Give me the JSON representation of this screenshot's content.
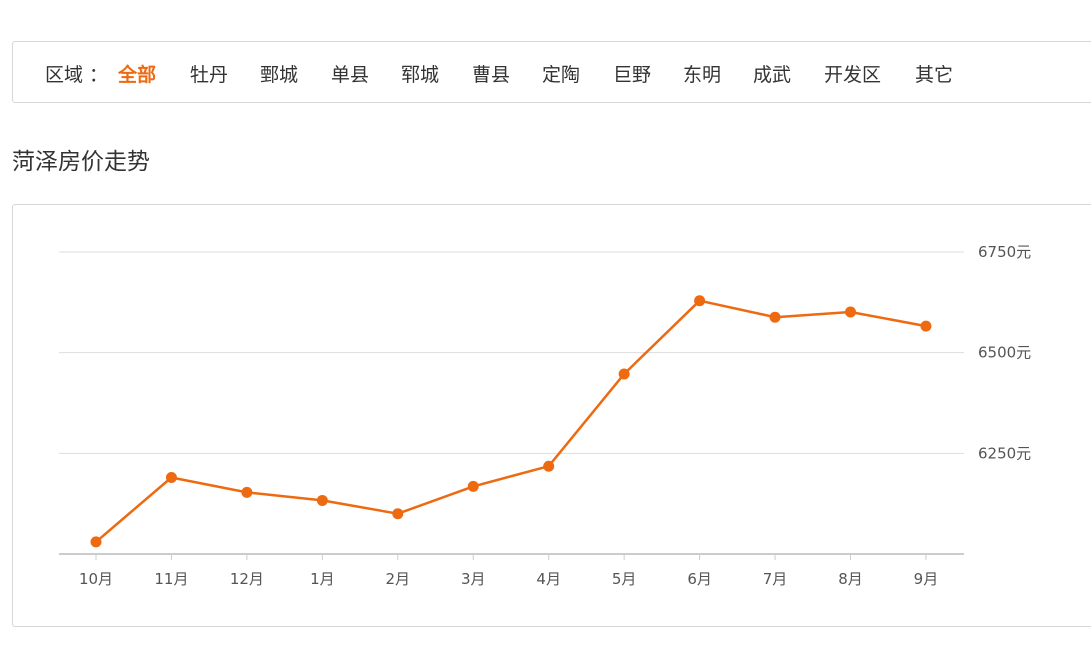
{
  "filter": {
    "label": "区域 ：",
    "items": [
      {
        "label": "全部",
        "active": true
      },
      {
        "label": "牡丹",
        "active": false
      },
      {
        "label": "鄄城",
        "active": false
      },
      {
        "label": "单县",
        "active": false
      },
      {
        "label": "郓城",
        "active": false
      },
      {
        "label": "曹县",
        "active": false
      },
      {
        "label": "定陶",
        "active": false
      },
      {
        "label": "巨野",
        "active": false
      },
      {
        "label": "东明",
        "active": false
      },
      {
        "label": "成武",
        "active": false
      },
      {
        "label": "开发区",
        "active": false
      },
      {
        "label": "其它",
        "active": false
      }
    ]
  },
  "section_title": "菏泽房价走势",
  "colors": {
    "accent": "#ee6a11",
    "line": "#ee6a11",
    "grid": "#dddddd",
    "axis": "#cccccc"
  },
  "chart_data": {
    "type": "line",
    "title": "",
    "xlabel": "",
    "ylabel": "",
    "categories": [
      "10月",
      "11月",
      "12月",
      "1月",
      "2月",
      "3月",
      "4月",
      "5月",
      "6月",
      "7月",
      "8月",
      "9月"
    ],
    "series": [
      {
        "values": [
          6030,
          6190,
          6153,
          6133,
          6100,
          6168,
          6218,
          6447,
          6629,
          6588,
          6601,
          6566
        ]
      }
    ],
    "y_ticks": [
      6250,
      6500,
      6750
    ],
    "y_tick_labels": [
      "6250元",
      "6500元",
      "6750元"
    ],
    "ylim": [
      6000,
      6750
    ],
    "grid": true,
    "y_axis_position": "right"
  }
}
